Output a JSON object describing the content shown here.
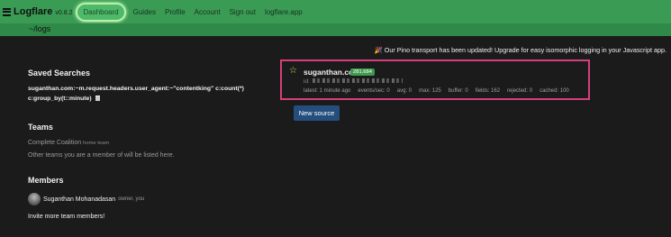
{
  "nav": {
    "brand": "Logflare",
    "version": "v0.8.2",
    "links": [
      "Dashboard",
      "Guides",
      "Profile",
      "Account",
      "Sign out",
      "logflare.app"
    ]
  },
  "path": "~/logs",
  "announcement": "🎉 Our Pino transport has been updated! Upgrade for easy isomorphic logging in your Javascript app.",
  "saved_searches": {
    "title": "Saved Searches",
    "queries": [
      "suganthan.com:~m.request.headers.user_agent:~\"contentking\" c:count(*)",
      "c:group_by(t::minute)"
    ]
  },
  "teams": {
    "title": "Teams",
    "team_name": "Complete Coalition",
    "team_tag": "home team",
    "note": "Other teams you are a member of will be listed here."
  },
  "members": {
    "title": "Members",
    "name": "Suganthan Mohanadasan",
    "role": "owner, you",
    "invite": "Invite more team members!"
  },
  "source": {
    "name": "suganthan.com",
    "count": "281,684",
    "id_label": "id:",
    "stats": {
      "latest": "latest: 1 minute ago",
      "events": "events/sec: 0",
      "avg": "avg: 0",
      "max": "max: 125",
      "buffer": "buffer: 0",
      "fields": "fields: 162",
      "rejected": "rejected: 0",
      "cached": "cached: 100"
    }
  },
  "new_source_label": "New source",
  "colors": {
    "nav_green": "#3a9b55",
    "subbar_green": "#2f8a49",
    "highlight_pink": "#d6407a",
    "button_blue": "#244e7d",
    "badge_green": "#3f9a4d"
  }
}
